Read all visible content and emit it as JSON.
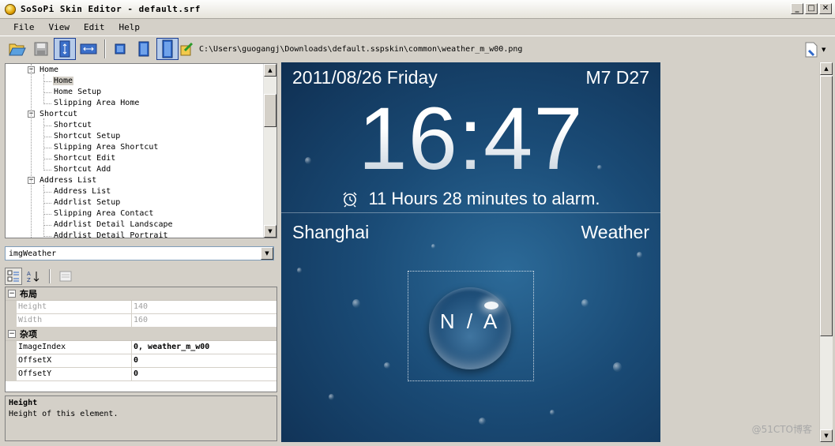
{
  "window": {
    "title": "SoSoPi Skin Editor - default.srf",
    "min": "_",
    "max": "□",
    "close": "✕"
  },
  "menu": [
    "File",
    "View",
    "Edit",
    "Help"
  ],
  "toolbar": {
    "path": "C:\\Users\\guogangj\\Downloads\\default.sspskin\\common\\weather_m_w00.png"
  },
  "tree": {
    "items": [
      {
        "label": "Home",
        "level": 0,
        "expander": "−"
      },
      {
        "label": "Home",
        "level": 1,
        "selected": true
      },
      {
        "label": "Home Setup",
        "level": 1
      },
      {
        "label": "Slipping Area Home",
        "level": 1
      },
      {
        "label": "Shortcut",
        "level": 0,
        "expander": "−"
      },
      {
        "label": "Shortcut",
        "level": 1
      },
      {
        "label": "Shortcut Setup",
        "level": 1
      },
      {
        "label": "Slipping Area Shortcut",
        "level": 1
      },
      {
        "label": "Shortcut Edit",
        "level": 1
      },
      {
        "label": "Shortcut Add",
        "level": 1
      },
      {
        "label": "Address List",
        "level": 0,
        "expander": "−"
      },
      {
        "label": "Address List",
        "level": 1
      },
      {
        "label": "Addrlist Setup",
        "level": 1
      },
      {
        "label": "Slipping Area Contact",
        "level": 1
      },
      {
        "label": "Addrlist Detail Landscape",
        "level": 1
      },
      {
        "label": "Addrlist Detail Portrait",
        "level": 1
      }
    ]
  },
  "combo": {
    "value": "imgWeather"
  },
  "properties": {
    "categories": [
      {
        "name": "布局",
        "toggle": "−",
        "rows": [
          {
            "name": "Height",
            "value": "140",
            "disabled": true
          },
          {
            "name": "Width",
            "value": "160",
            "disabled": true
          }
        ]
      },
      {
        "name": "杂项",
        "toggle": "−",
        "rows": [
          {
            "name": "ImageIndex",
            "value": "0, weather_m_w00"
          },
          {
            "name": "OffsetX",
            "value": "0"
          },
          {
            "name": "OffsetY",
            "value": "0"
          }
        ]
      }
    ]
  },
  "description": {
    "title": "Height",
    "text": "Height of this element."
  },
  "preview": {
    "date": "2011/08/26 Friday",
    "lunar": "M7 D27",
    "time": "16:47",
    "alarm": "11 Hours 28 minutes to alarm.",
    "city": "Shanghai",
    "weather_label": "Weather",
    "na": "N / A"
  },
  "watermark": "@51CTO博客"
}
